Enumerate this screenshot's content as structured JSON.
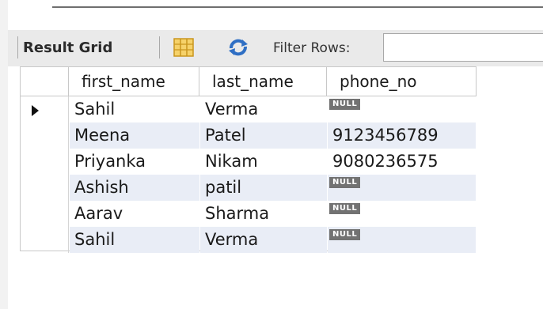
{
  "toolbar": {
    "result_grid_label": "Result Grid",
    "filter_label": "Filter Rows:",
    "filter_value": ""
  },
  "columns": [
    "first_name",
    "last_name",
    "phone_no"
  ],
  "rows": [
    {
      "first_name": "Sahil",
      "last_name": "Verma",
      "phone_no": "NULL",
      "current": true
    },
    {
      "first_name": "Meena",
      "last_name": "Patel",
      "phone_no": "9123456789",
      "current": false
    },
    {
      "first_name": "Priyanka",
      "last_name": "Nikam",
      "phone_no": "9080236575",
      "current": false
    },
    {
      "first_name": "Ashish",
      "last_name": "patil",
      "phone_no": "NULL",
      "current": false
    },
    {
      "first_name": "Aarav",
      "last_name": "Sharma",
      "phone_no": "NULL",
      "current": false
    },
    {
      "first_name": "Sahil",
      "last_name": "Verma",
      "phone_no": "NULL",
      "current": false
    }
  ],
  "colors": {
    "toolbar_bg": "#eaeaea",
    "row_shade": "#e9edf6",
    "null_badge": "#727272"
  },
  "icons": {
    "grid_view": "grid-view-icon",
    "refresh": "refresh-icon",
    "current_row": "current-row-arrow-icon"
  }
}
